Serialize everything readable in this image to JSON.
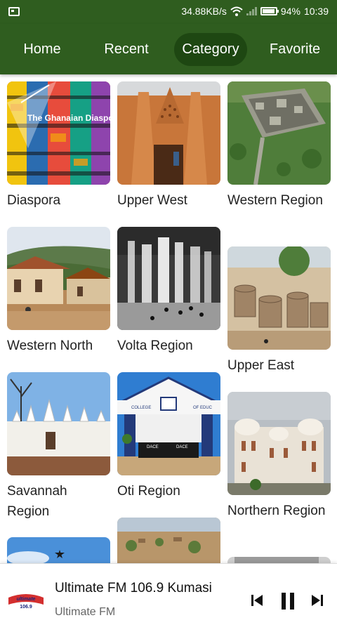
{
  "status": {
    "speed": "34.88KB/s",
    "battery": "94%",
    "time": "10:39"
  },
  "tabs": [
    {
      "label": "Home"
    },
    {
      "label": "Recent"
    },
    {
      "label": "Category",
      "active": true
    },
    {
      "label": "Favorite"
    }
  ],
  "categories": {
    "col1": [
      "Diaspora",
      "Western North",
      "Savannah Region",
      ""
    ],
    "col2": [
      "Upper West",
      "Volta Region",
      "Oti Region",
      ""
    ],
    "col3": [
      "Western Region",
      "Upper East",
      "Northern Region",
      ""
    ]
  },
  "thumb_text": {
    "diaspora": "The Ghanaian Diaspora",
    "oti_sign_left": "COLLEGE",
    "oti_sign_right": "OF EDUC",
    "oti_gate_left": "DACE",
    "oti_gate_right": "DACE"
  },
  "player": {
    "title": "Ultimate FM 106.9 Kumasi",
    "subtitle": "Ultimate FM",
    "logo_text": "ultimate",
    "logo_freq": "106.9"
  },
  "colors": {
    "primary": "#2f5d1f",
    "active_tab": "#1e4712"
  }
}
